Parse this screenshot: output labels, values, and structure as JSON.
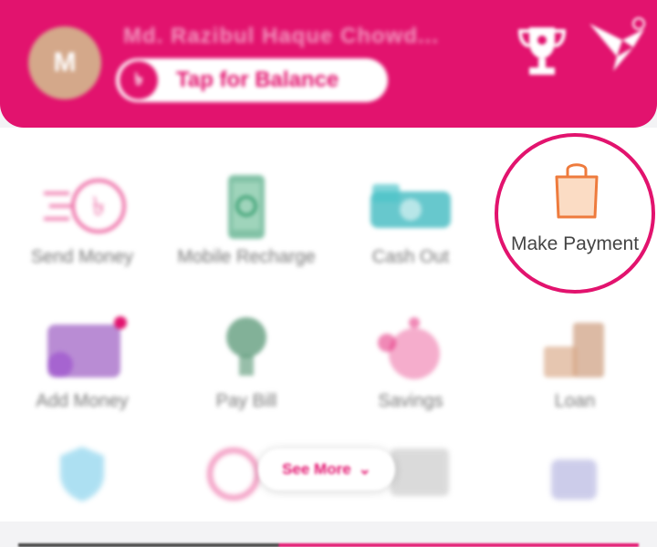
{
  "header": {
    "avatar_initial": "M",
    "user_name": "Md. Razibul Haque Chowd...",
    "balance_button_label": "Tap for Balance",
    "balance_coin_symbol": "৳"
  },
  "services": [
    {
      "label": "Send Money",
      "icon": "send-money-icon"
    },
    {
      "label": "Mobile Recharge",
      "icon": "mobile-recharge-icon"
    },
    {
      "label": "Cash Out",
      "icon": "cash-out-icon"
    },
    {
      "label": "Make Payment",
      "icon": "shopping-bag-icon"
    },
    {
      "label": "Add Money",
      "icon": "add-money-icon"
    },
    {
      "label": "Pay Bill",
      "icon": "pay-bill-icon"
    },
    {
      "label": "Savings",
      "icon": "savings-icon"
    },
    {
      "label": "Loan",
      "icon": "loan-icon"
    }
  ],
  "see_more": {
    "label": "See More"
  },
  "colors": {
    "brand": "#e2136e",
    "bag_fill": "#fbdcc4",
    "bag_stroke": "#ee7b3d"
  }
}
